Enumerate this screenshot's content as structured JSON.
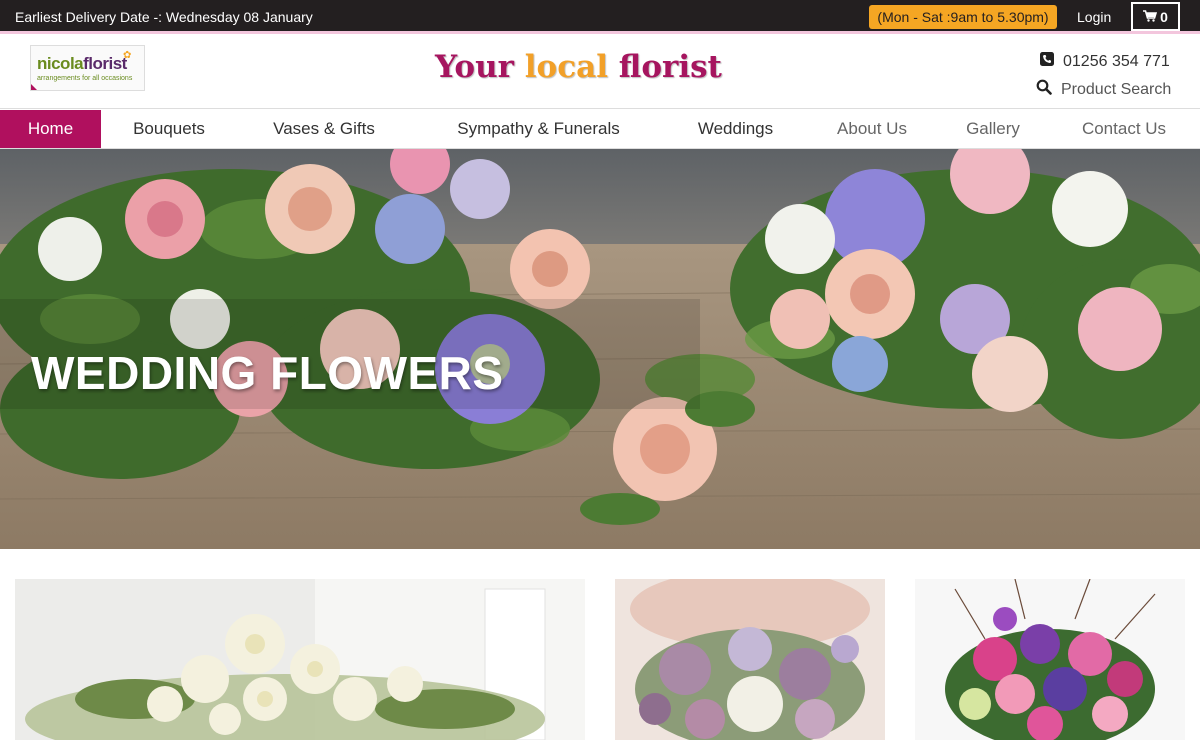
{
  "topbar": {
    "delivery_text": "Earliest Delivery Date -: Wednesday 08 January",
    "hours": "(Mon - Sat :9am to 5.30pm)",
    "login": "Login",
    "cart_count": "0"
  },
  "header": {
    "logo": {
      "name_part1": "nicola",
      "name_part2": "florist",
      "tagline": "arrangements for all occasions"
    },
    "tagline_part1": "Your ",
    "tagline_part2": "local",
    "tagline_part3": " florist",
    "phone": "01256 354 771",
    "search_label": "Product Search"
  },
  "nav": {
    "items": [
      {
        "label": "Home"
      },
      {
        "label": "Bouquets"
      },
      {
        "label": "Vases & Gifts"
      },
      {
        "label": "Sympathy & Funerals"
      },
      {
        "label": "Weddings"
      },
      {
        "label": "About Us"
      },
      {
        "label": "Gallery"
      },
      {
        "label": "Contact Us"
      }
    ]
  },
  "hero": {
    "title": "WEDDING FLOWERS"
  },
  "colors": {
    "brand_pink": "#b0105e",
    "accent_orange": "#f5a623",
    "topbar_bg": "#231f20"
  },
  "icons": [
    "phone-icon",
    "search-icon",
    "cart-icon"
  ]
}
